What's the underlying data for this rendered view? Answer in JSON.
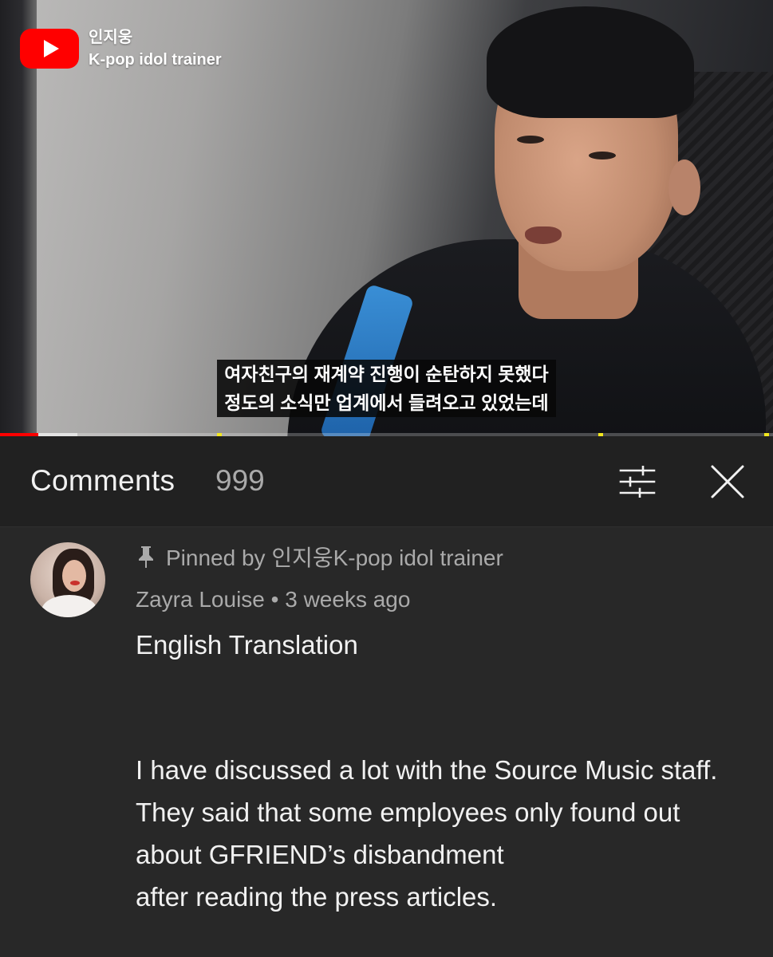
{
  "video": {
    "channel_name": "인지웅",
    "channel_subtitle": "K-pop idol trainer",
    "subtitle_lines": [
      "여자친구의 재계약 진행이 순탄하지 못했다",
      "정도의 소식만 업계에서 들려오고 있었는데"
    ],
    "progress": {
      "played_fraction": 0.05,
      "buffered_fraction": 0.1
    }
  },
  "comments_panel": {
    "title": "Comments",
    "count": "999",
    "filter_icon": "sort-filter-icon",
    "close_icon": "close-icon"
  },
  "comment": {
    "pinned_label": "Pinned by 인지웅K-pop idol trainer",
    "meta": "Zayra Louise • 3 weeks ago",
    "heading": "English Translation",
    "lines": [
      "I have discussed a lot with the Source Music staff.",
      "They said that some employees only found out about GFRIEND’s disbandment",
      "after reading the press articles."
    ]
  },
  "colors": {
    "panel_bg": "#212121",
    "comment_bg": "#282828",
    "youtube_red": "#ff0000",
    "secondary_text": "#aaaaaa"
  }
}
